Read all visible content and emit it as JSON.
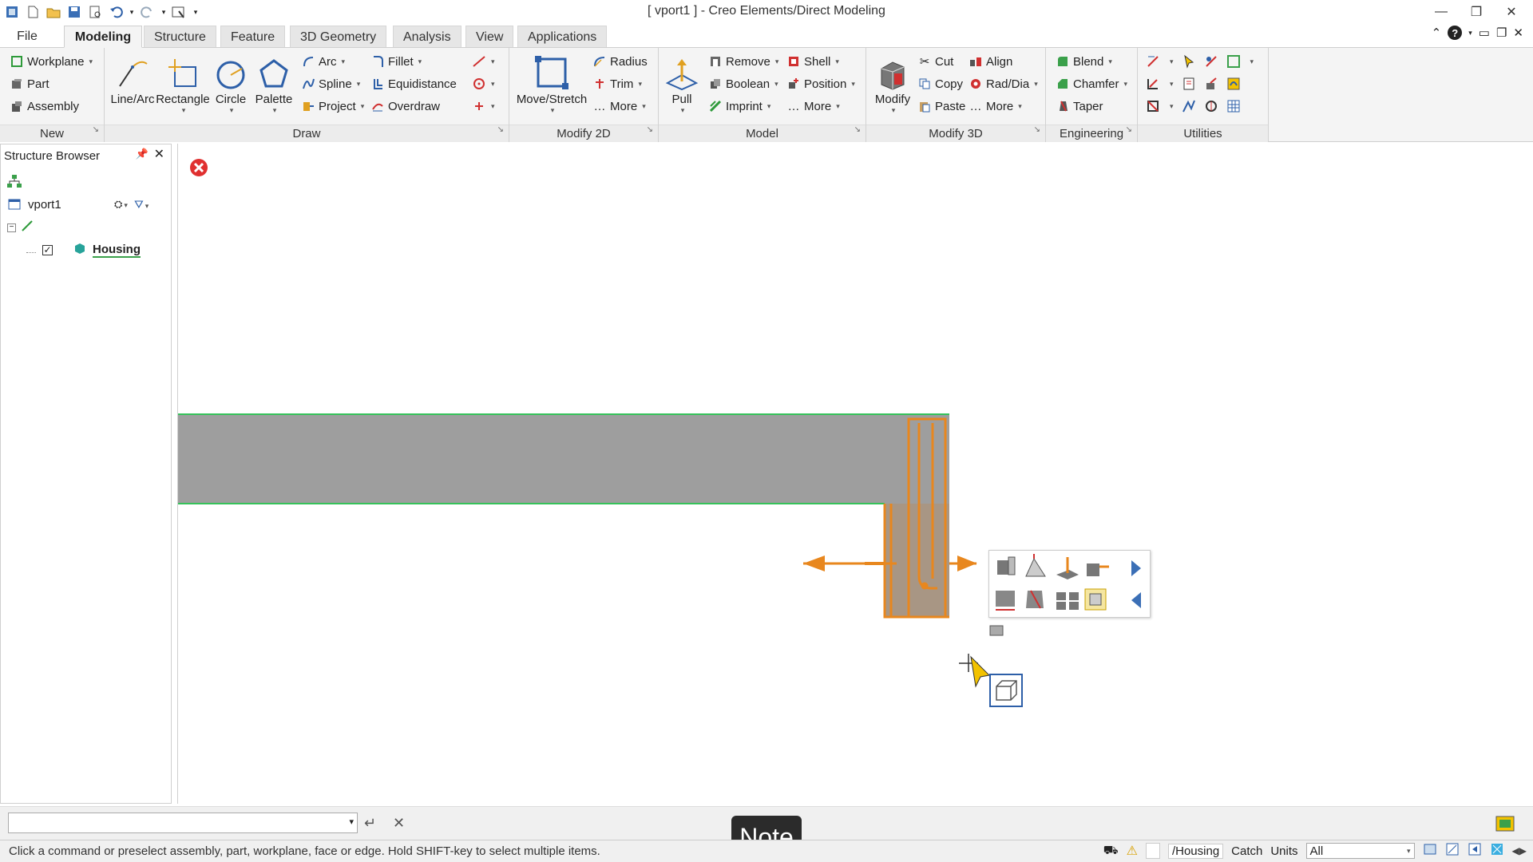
{
  "window": {
    "title": "[ vport1 ] - Creo Elements/Direct Modeling"
  },
  "tabs": [
    {
      "label": "File"
    },
    {
      "label": "Modeling"
    },
    {
      "label": "Structure"
    },
    {
      "label": "Feature"
    },
    {
      "label": "3D Geometry"
    },
    {
      "label": "Analysis"
    },
    {
      "label": "View"
    },
    {
      "label": "Applications"
    }
  ],
  "ribbon": {
    "new": {
      "label": "New",
      "workplane": "Workplane",
      "part": "Part",
      "assembly": "Assembly"
    },
    "draw": {
      "label": "Draw",
      "line_arc": "Line/Arc",
      "rectangle": "Rectangle",
      "circle": "Circle",
      "palette": "Palette",
      "arc": "Arc",
      "spline": "Spline",
      "project": "Project",
      "fillet": "Fillet",
      "equidistance": "Equidistance",
      "overdraw": "Overdraw"
    },
    "modify2d": {
      "label": "Modify 2D",
      "move_stretch": "Move/Stretch",
      "radius": "Radius",
      "trim": "Trim",
      "more": "More"
    },
    "model": {
      "label": "Model",
      "pull": "Pull",
      "remove": "Remove",
      "boolean": "Boolean",
      "imprint": "Imprint",
      "shell": "Shell",
      "position": "Position",
      "more": "More"
    },
    "modify3d": {
      "label": "Modify 3D",
      "modify": "Modify",
      "cut": "Cut",
      "copy": "Copy",
      "paste": "Paste",
      "align": "Align",
      "rad_dia": "Rad/Dia",
      "more": "More"
    },
    "engineering": {
      "label": "Engineering",
      "blend": "Blend",
      "chamfer": "Chamfer",
      "taper": "Taper"
    },
    "utilities": {
      "label": "Utilities"
    }
  },
  "structure_browser": {
    "title": "Structure Browser",
    "viewport": "vport1",
    "tree": [
      {
        "label": "Housing",
        "checked": true
      }
    ]
  },
  "colors": {
    "accent_orange": "#e8871e",
    "part_gray": "#9e9e9e",
    "edge_green": "#35c25a",
    "error_red": "#e03030"
  },
  "commandline": {
    "value": ""
  },
  "status": {
    "message": "Click a command or preselect assembly, part, workplane, face or edge. Hold SHIFT-key to select multiple items.",
    "path": "/Housing",
    "catch": "Catch",
    "units": "Units",
    "filter": "All"
  },
  "note": "Note"
}
